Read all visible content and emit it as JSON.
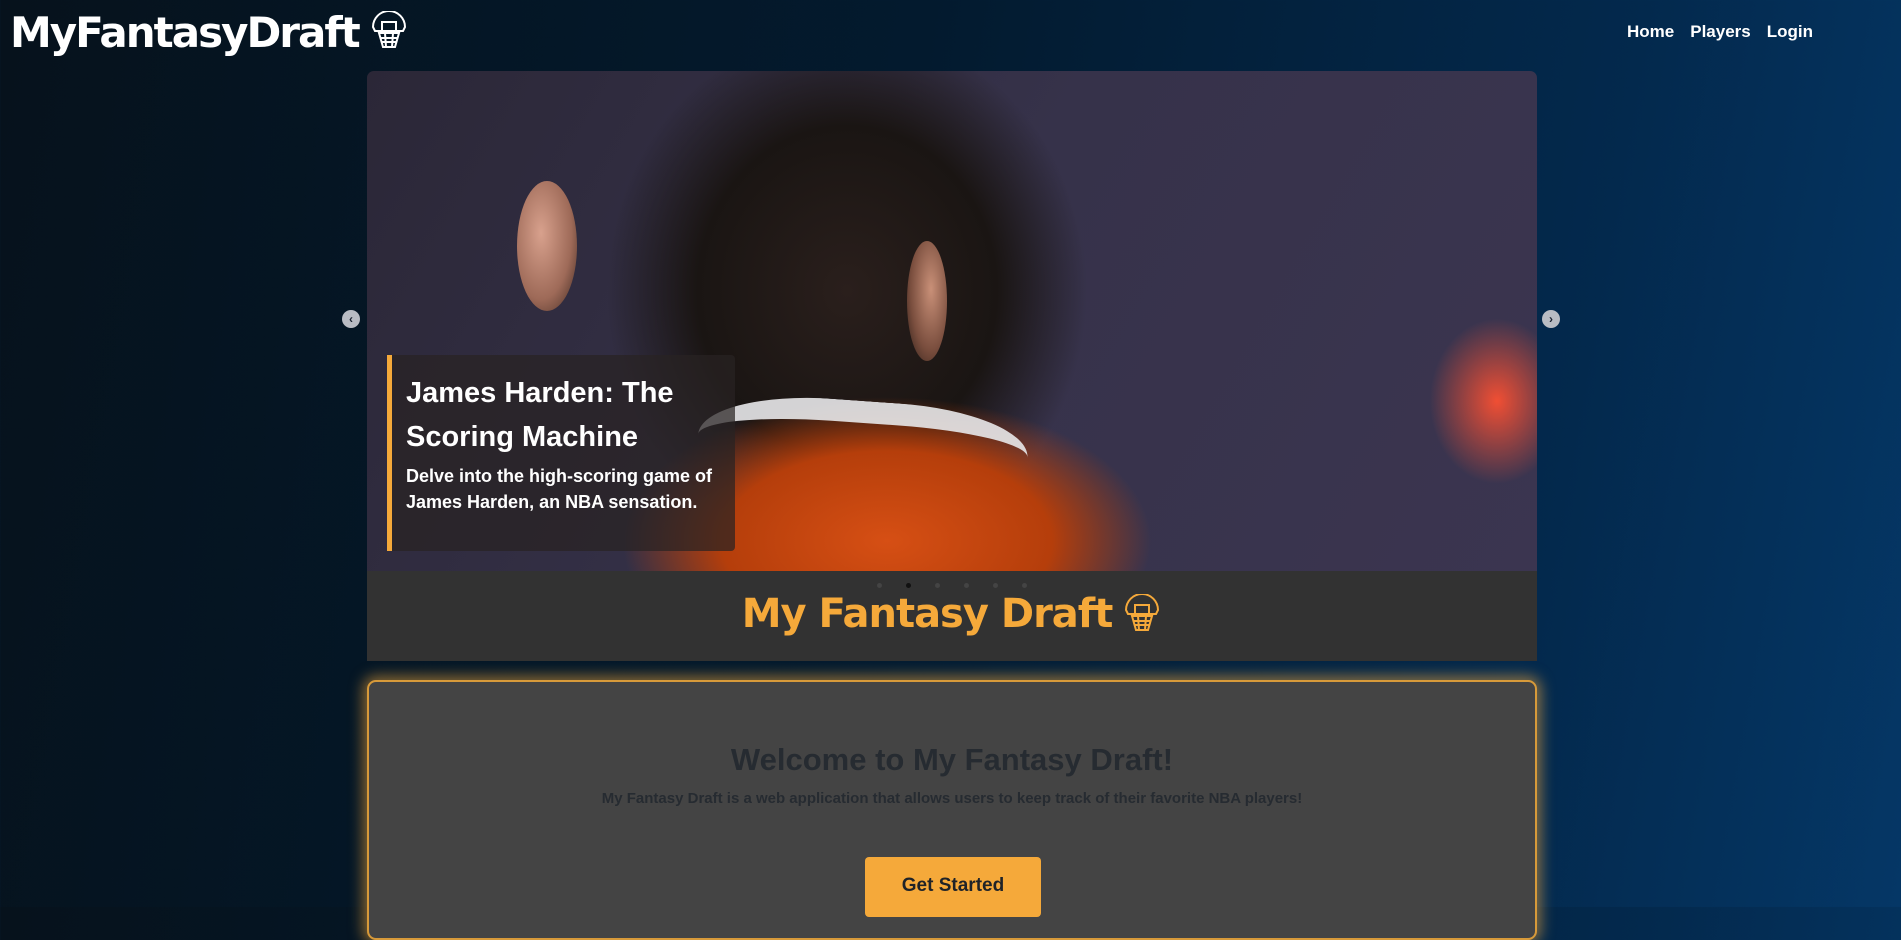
{
  "brand": {
    "title": "MyFantasyDraft",
    "icon": "basketball-hoop-icon"
  },
  "nav": {
    "home": "Home",
    "players": "Players",
    "login": "Login"
  },
  "carousel": {
    "caption_title": "James Harden: The Scoring Machine",
    "caption_text": "Delve into the high-scoring game of James Harden, an NBA sensation.",
    "prev_icon": "chevron-left-icon",
    "next_icon": "chevron-right-icon",
    "prev_glyph": "‹",
    "next_glyph": "›",
    "slide_count": 6,
    "active_slide": 2
  },
  "band": {
    "title": "My Fantasy Draft",
    "icon": "basketball-hoop-icon"
  },
  "welcome": {
    "title": "Welcome to My Fantasy Draft!",
    "subtitle": "My Fantasy Draft is a web application that allows users to keep track of their favorite NBA players!",
    "cta": "Get Started"
  },
  "colors": {
    "accent": "#f5a93a",
    "band_bg": "#323232",
    "card_bg": "#444444"
  }
}
